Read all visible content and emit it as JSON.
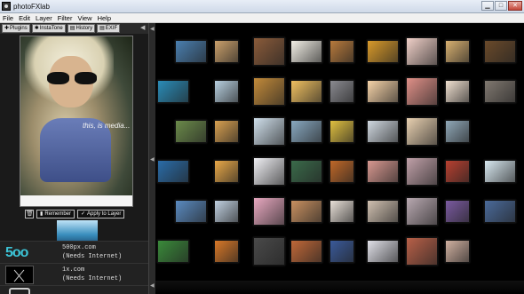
{
  "window": {
    "title": "photoFXlab",
    "controls": [
      "minimize",
      "maximize",
      "close"
    ]
  },
  "menu": {
    "items": [
      "File",
      "Edit",
      "Layer",
      "Filter",
      "View",
      "Help"
    ]
  },
  "tabs": [
    {
      "label": "Plugins",
      "icon": "puzzle-icon"
    },
    {
      "label": "InstaTone",
      "icon": "tone-icon"
    },
    {
      "label": "History",
      "icon": "history-icon"
    },
    {
      "label": "EXIF",
      "icon": "exif-icon"
    }
  ],
  "preview": {
    "caption": "this, is media..."
  },
  "actions": {
    "remember_label": "Remember",
    "apply_label": "Apply to Layer"
  },
  "sources": [
    {
      "name": "500px.com",
      "note": "(Needs Internet)",
      "logo": "500px-logo"
    },
    {
      "name": "1x.com",
      "note": "(Needs Internet)",
      "logo": "1x-logo"
    }
  ],
  "colors": {
    "gallery_background": "#000000",
    "panel_background": "#1a1a1a",
    "logo_500": "#3cc3d6"
  },
  "gallery": {
    "rows": 7,
    "thumb_colors": [
      [
        "#4a7fb0",
        "#caa06b",
        "#8a5b3a",
        "#f2efe6",
        "#b87a3c",
        "#d99a2a",
        "#f0d0c8",
        "#d8b070",
        "#6a4a2a"
      ],
      [
        "#2a8cb8",
        "#b8d0e0",
        "#c28a3a",
        "#f0c060",
        "#8a8a90",
        "#f6d3a8",
        "#e09088",
        "#f0e0d0",
        "#807870"
      ],
      [
        "#6b8a4a",
        "#d8a050",
        "#d0e0ec",
        "#88a8c0",
        "#e0c040",
        "#d0d8e0",
        "#e8d0b0",
        "#90a8b8"
      ],
      [
        "#2a6ca8",
        "#e8a848",
        "#f0f0f4",
        "#3a6a4a",
        "#c06828",
        "#d89890",
        "#c0a0a8",
        "#b84030",
        "#d8e8f0"
      ],
      [
        "#5a8ac0",
        "#c0d0e0",
        "#e8a8c0",
        "#c89060",
        "#e8e0d8",
        "#d0c0b0",
        "#b8a8b0",
        "#7a5aa0",
        "#4a6a9a"
      ],
      [
        "#3a8a3a",
        "#d87828",
        "#4a4a4a",
        "#c06838",
        "#3a5a9a",
        "#e0e0e8",
        "#b86048",
        "#d0b0a0"
      ]
    ]
  }
}
